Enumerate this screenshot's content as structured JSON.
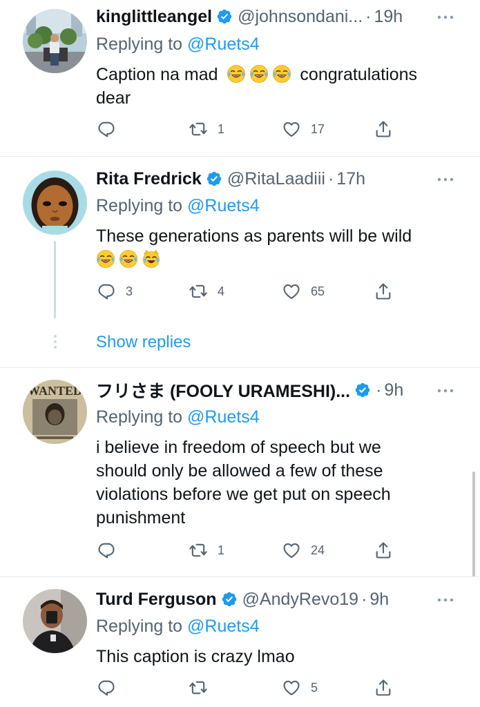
{
  "replies": [
    {
      "name": "kinglittleangel",
      "handle": "@johnsondani...",
      "dot": "·",
      "time": "19h",
      "replying_prefix": "Replying to ",
      "replying_to": "@Ruets4",
      "text_before": "Caption na mad",
      "emojis": [
        "face-with-tears-of-joy",
        "face-with-tears-of-joy",
        "face-with-tears-of-joy"
      ],
      "text_after": "congratulations dear",
      "replies_count": "",
      "retweets_count": "1",
      "likes_count": "17"
    },
    {
      "name": "Rita Fredrick",
      "handle": "@RitaLaadiii",
      "dot": "·",
      "time": "17h",
      "replying_prefix": "Replying to ",
      "replying_to": "@Ruets4",
      "text": "These generations as parents will be wild",
      "emojis": [
        "face-with-tears-of-joy",
        "face-with-tears-of-joy",
        "cat-with-tears-of-joy"
      ],
      "replies_count": "3",
      "retweets_count": "4",
      "likes_count": "65",
      "show_replies": "Show replies"
    },
    {
      "name": "フリさま (FOOLY URAMESHI)...",
      "handle": "",
      "dot": "·",
      "time": "9h",
      "replying_prefix": "Replying to ",
      "replying_to": "@Ruets4",
      "text": "i believe in freedom of speech but we should only be allowed a few of these violations before we get put on speech punishment",
      "replies_count": "",
      "retweets_count": "1",
      "likes_count": "24",
      "avatar_text": "WANTED"
    },
    {
      "name": "Turd Ferguson",
      "handle": "@AndyRevo19",
      "dot": "·",
      "time": "9h",
      "replying_prefix": "Replying to ",
      "replying_to": "@Ruets4",
      "text": "This caption is crazy lmao",
      "replies_count": "",
      "retweets_count": "",
      "likes_count": "5"
    }
  ],
  "icons": {
    "reply": "reply-icon",
    "retweet": "retweet-icon",
    "like": "heart-icon",
    "share": "share-icon",
    "more": "more-icon",
    "verified": "verified-badge-icon"
  },
  "colors": {
    "link": "#1d9bf0",
    "verified": "#1d9bf0",
    "muted": "#536471",
    "divider": "#e6ecf0"
  }
}
